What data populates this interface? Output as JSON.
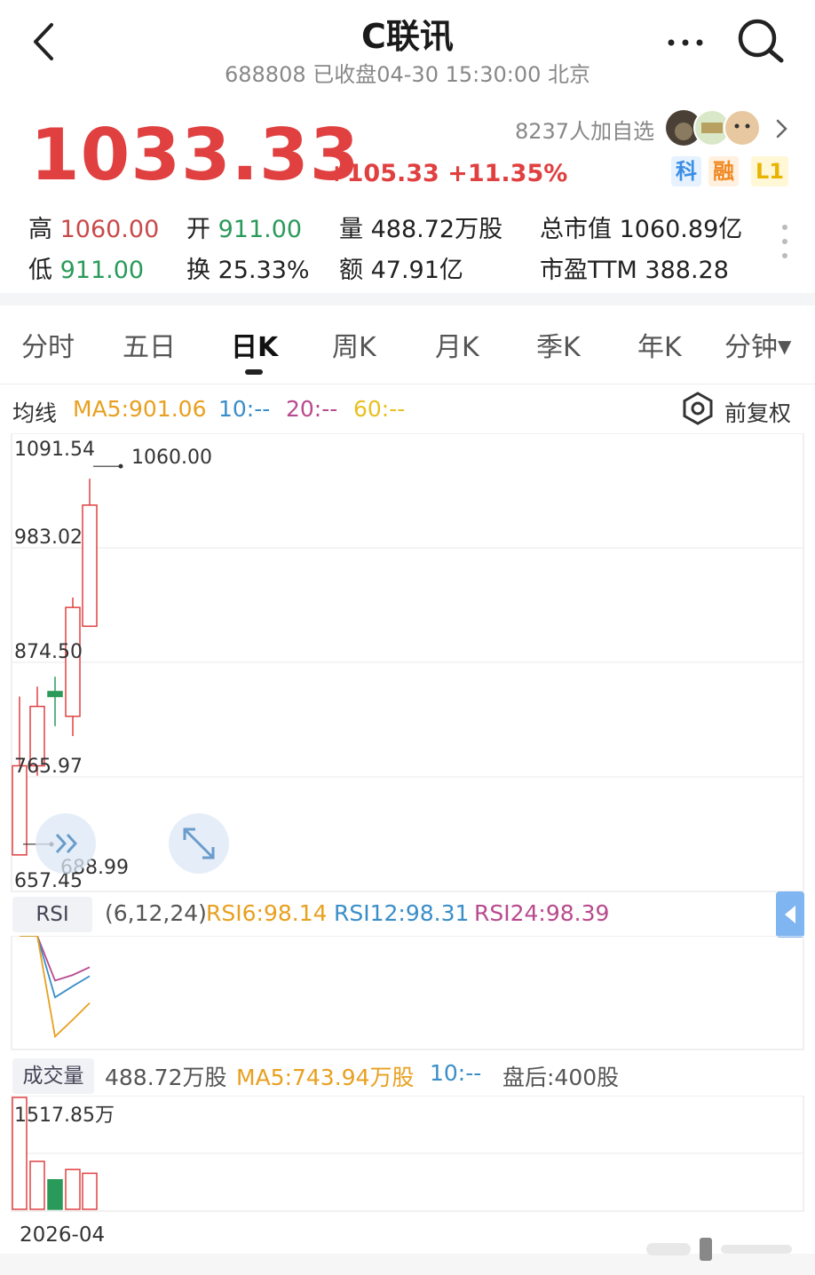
{
  "header": {
    "title": "C联讯",
    "subtitle": "688808 已收盘04-30 15:30:00 北京"
  },
  "quote": {
    "price": "1033.33",
    "change": "+105.33 +11.35%",
    "follow_count": "8237人加自选",
    "tags": [
      "科",
      "融",
      "L1"
    ]
  },
  "stats": {
    "high_label": "高",
    "high_value": "1060.00",
    "open_label": "开",
    "open_value": "911.00",
    "volume_label": "量",
    "volume_value": "488.72万股",
    "mktcap_label": "总市值",
    "mktcap_value": "1060.89亿",
    "low_label": "低",
    "low_value": "911.00",
    "turnover_label": "换",
    "turnover_value": "25.33%",
    "amount_label": "额",
    "amount_value": "47.91亿",
    "pe_label": "市盈TTM",
    "pe_value": "388.28"
  },
  "tabs": [
    "分时",
    "五日",
    "日K",
    "周K",
    "月K",
    "季K",
    "年K",
    "分钟"
  ],
  "active_tab": "日K",
  "ma": {
    "label": "均线",
    "ma5": "MA5:901.06",
    "ma10": "10:--",
    "ma20": "20:--",
    "ma60": "60:--",
    "adjust_label": "前复权"
  },
  "rsi": {
    "label": "RSI",
    "params": "(6,12,24)",
    "rsi6": "RSI6:98.14",
    "rsi12": "RSI12:98.31",
    "rsi24": "RSI24:98.39"
  },
  "volume": {
    "label": "成交量",
    "value": "488.72万股",
    "ma5": "MA5:743.94万股",
    "ma10": "10:--",
    "after_hours": "盘后:400股"
  },
  "colors": {
    "up": "#e04040",
    "down": "#2a9a5a",
    "ma5": "#e8a020",
    "ma10": "#3a8ec8",
    "ma20": "#b84a8e",
    "ma60": "#e8c020"
  },
  "chart_data": {
    "type": "candlestick",
    "y_ticks": [
      "1091.54",
      "983.02",
      "874.50",
      "765.97",
      "657.45"
    ],
    "ylim": [
      657.45,
      1091.54
    ],
    "max_label": "1060.00",
    "min_label": "688.99",
    "candles": [
      {
        "open": 680,
        "close": 770,
        "high": 840,
        "low": 688.99
      },
      {
        "open": 830,
        "close": 770,
        "high": 850,
        "low": 760,
        "dir": "up"
      },
      {
        "open": 845,
        "close": 840,
        "high": 860,
        "low": 810
      },
      {
        "open": 820,
        "close": 930,
        "high": 940,
        "low": 800
      },
      {
        "open": 911,
        "close": 1033.33,
        "high": 1060,
        "low": 911
      }
    ],
    "volume_max_label": "1517.85万",
    "volume_values": [
      1517.85,
      650,
      400,
      540,
      488.72
    ],
    "volume_ylim": [
      0,
      1517.85
    ],
    "volume_dir": [
      "up",
      "up",
      "down",
      "up",
      "up"
    ],
    "rsi6": [
      100,
      100,
      60,
      65,
      72
    ],
    "rsi12": [
      100,
      100,
      45,
      55,
      64
    ],
    "rsi24": [
      100,
      100,
      10,
      25,
      40
    ],
    "rsi_ylim": [
      0,
      100
    ],
    "x_label": "2026-04"
  }
}
